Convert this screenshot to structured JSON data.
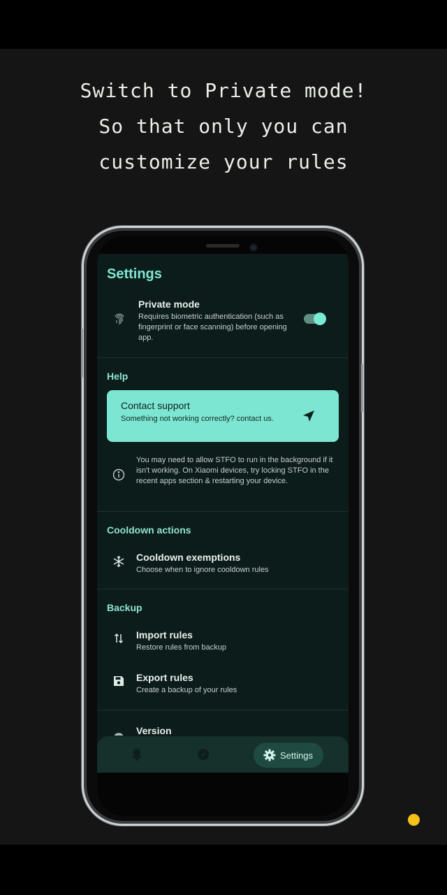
{
  "promo": {
    "line1": "Switch to Private mode!",
    "line2": "So that only you can",
    "line3": "customize your rules"
  },
  "settings": {
    "title": "Settings",
    "private_mode": {
      "title": "Private mode",
      "description": "Requires biometric authentication (such as fingerprint or face scanning) before opening app.",
      "enabled": true,
      "icon": "fingerprint-icon"
    },
    "help": {
      "header": "Help",
      "contact": {
        "title": "Contact support",
        "description": "Something not working correctly? contact us.",
        "icon": "send-icon"
      },
      "info": {
        "text": "You may need to allow STFO to run in the background if it isn't working. On Xiaomi devices, try locking STFO in the recent apps section & restarting your device.",
        "icon": "info-icon"
      }
    },
    "cooldown": {
      "header": "Cooldown actions",
      "exemptions": {
        "title": "Cooldown exemptions",
        "description": "Choose when to ignore cooldown rules",
        "icon": "snowflake-icon"
      }
    },
    "backup": {
      "header": "Backup",
      "import": {
        "title": "Import rules",
        "description": "Restore rules from backup",
        "icon": "swap-vertical-icon"
      },
      "export": {
        "title": "Export rules",
        "description": "Create a backup of your rules",
        "icon": "save-icon"
      }
    },
    "version": {
      "title": "Version",
      "icon": "android-icon"
    }
  },
  "nav": {
    "items": [
      {
        "icon": "bell-icon",
        "label": ""
      },
      {
        "icon": "compass-icon",
        "label": ""
      },
      {
        "icon": "gear-icon",
        "label": "Settings",
        "active": true
      }
    ]
  },
  "colors": {
    "accent": "#7de6d2",
    "background": "#0c1c1a",
    "indicator": "#f5c21b"
  }
}
